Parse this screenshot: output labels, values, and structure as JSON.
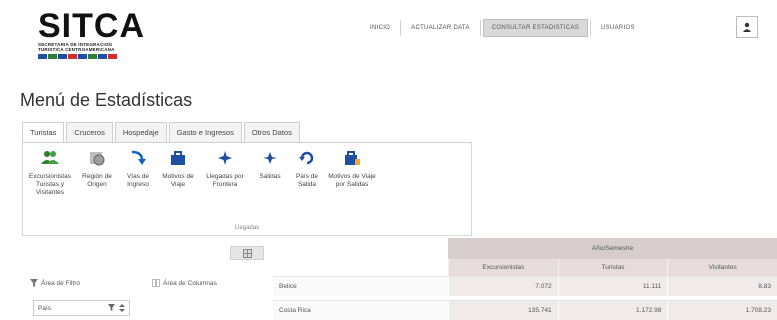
{
  "brand": {
    "name": "SITCA",
    "subtitle_lines": [
      "SECRETARIA DE INTEGRACION",
      "TURISTICA CENTROAMERICANA"
    ],
    "flag_colors": [
      "#1f4fa3",
      "#2e7d32",
      "#1f4fa3",
      "#d32f2f",
      "#1f4fa3",
      "#2e7d32",
      "#1f4fa3",
      "#d32f2f"
    ]
  },
  "topnav": {
    "items": [
      {
        "label": "INICIO",
        "active": false
      },
      {
        "label": "ACTUALIZAR DATA",
        "active": false
      },
      {
        "label": "CONSULTAR ESTADISTICAS",
        "active": true
      },
      {
        "label": "USUARIOS",
        "active": false
      }
    ],
    "user_icon": "user-icon"
  },
  "page": {
    "title": "Menú de Estadísticas"
  },
  "tabs": [
    {
      "label": "Turistas",
      "active": true
    },
    {
      "label": "Cruceros",
      "active": false
    },
    {
      "label": "Hospedaje",
      "active": false
    },
    {
      "label": "Gasto e Ingresos",
      "active": false
    },
    {
      "label": "Otros Datos",
      "active": false
    }
  ],
  "ribbon": {
    "items": [
      {
        "label": "Excursionistas Turistas y Visitantes",
        "icon": "people-icon",
        "color": "#2e7d32"
      },
      {
        "label": "Región de Origen",
        "icon": "globe-icon",
        "color": "#555555"
      },
      {
        "label": "Vías de Ingreso",
        "icon": "arrow-down-icon",
        "color": "#1565c0"
      },
      {
        "label": "Motivos de Viaje",
        "icon": "briefcase-icon",
        "color": "#1f4fa3"
      },
      {
        "label": "Llegadas por Frontera",
        "icon": "airplane-icon",
        "color": "#1f4fa3"
      },
      {
        "label": "Salidas",
        "icon": "airplane-out-icon",
        "color": "#1f4fa3"
      },
      {
        "label": "País de Salida",
        "icon": "refresh-icon",
        "color": "#1f4fa3"
      },
      {
        "label": "Motivos de Viaje por Salidas",
        "icon": "luggage-icon",
        "color": "#1f4fa3"
      }
    ],
    "group_label": "Llegadas"
  },
  "pivot": {
    "toolbar_icon": "grid-icon",
    "header_band": "Año/Semestre",
    "columns": [
      "Excursionistas",
      "Turistas",
      "Visitantes"
    ],
    "filter_area_label": "Área de Filtro",
    "columns_area_label": "Área de Columnas",
    "filter_chip_label": "País",
    "rows": [
      {
        "label": "Belice",
        "values": [
          "7.072",
          "11.111",
          "8.83"
        ]
      },
      {
        "label": "Costa Rica",
        "values": [
          "135.741",
          "1.172.98",
          "1.708.23"
        ]
      }
    ]
  }
}
